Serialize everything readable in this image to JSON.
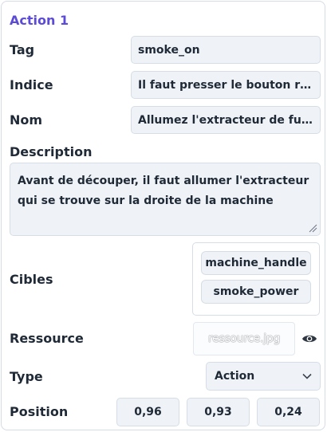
{
  "action": {
    "title": "Action 1",
    "tag": {
      "label": "Tag",
      "value": "smoke_on"
    },
    "indice": {
      "label": "Indice",
      "value": "Il faut presser le bouton ro..."
    },
    "nom": {
      "label": "Nom",
      "value": "Allumez l'extracteur de fu ..."
    },
    "description": {
      "label": "Description",
      "line1": "Avant de découper, il faut allumer l'extracteur",
      "line2": "qui se trouve sur la droite de la machine"
    },
    "cibles": {
      "label": "Cibles",
      "items": [
        "machine_handle",
        "smoke_power"
      ]
    },
    "ressource": {
      "label": "Ressource",
      "file": "ressource.jpg",
      "icon": "eye-icon"
    },
    "type": {
      "label": "Type",
      "selected": "Action",
      "icon": "chevron-down-icon"
    },
    "position": {
      "label": "Position",
      "x": "0,96",
      "y": "0,93",
      "z": "0,24"
    }
  },
  "colors": {
    "accent": "#5b4bd6",
    "field_bg": "#eff3f8",
    "border": "#d6dde6",
    "text": "#1f2a36"
  }
}
